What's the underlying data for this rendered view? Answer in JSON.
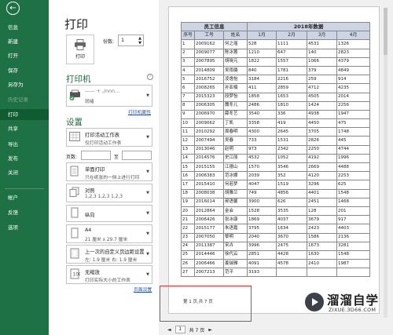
{
  "nav": {
    "back": "←",
    "items": [
      {
        "label": "信息",
        "state": "normal"
      },
      {
        "label": "新建",
        "state": "normal"
      },
      {
        "label": "打开",
        "state": "normal"
      },
      {
        "label": "保存",
        "state": "normal"
      },
      {
        "label": "另存为",
        "state": "normal"
      },
      {
        "label": "历史记录",
        "state": "dim"
      },
      {
        "label": "打印",
        "state": "active"
      },
      {
        "label": "共享",
        "state": "normal"
      },
      {
        "label": "导出",
        "state": "normal"
      },
      {
        "label": "发布",
        "state": "normal"
      },
      {
        "label": "关闭",
        "state": "normal"
      },
      {
        "label": "帐户",
        "state": "normal"
      },
      {
        "label": "反馈",
        "state": "normal"
      },
      {
        "label": "选项",
        "state": "normal"
      }
    ]
  },
  "print": {
    "title": "打印",
    "button_label": "打印",
    "copies_label": "份数:",
    "copies_value": "1"
  },
  "printer": {
    "heading": "打印机",
    "name": "—— + ,/nnn…",
    "status": "就绪",
    "properties_link": "打印机属性"
  },
  "settings": {
    "heading": "设置",
    "scope": {
      "t1": "打印活动工作表",
      "t2": "仅打印活动工作表"
    },
    "pages_label": "页数:",
    "pages_to": "至",
    "sides": {
      "t1": "单面打印",
      "t2": "只在纸张的一侧上进行打印"
    },
    "collate": {
      "t1": "对照",
      "t2": "1,2,3    1,2,3    1,2,3"
    },
    "orientation": {
      "t1": "纵向"
    },
    "paper": {
      "t1": "A4",
      "t2": "21 厘米 x 29.7 厘米"
    },
    "margins": {
      "t1": "上一次的自定义页边距设置",
      "t2": "左: 1.9 厘米    右: 1.9 厘米"
    },
    "scaling": {
      "t1": "无缩放",
      "t2": "打印实际大小的工作表"
    },
    "page_setup_link": "页面设置"
  },
  "preview": {
    "hdr_left": "员工信息",
    "hdr_right": "2018年数据",
    "columns": [
      "序号",
      "工号",
      "姓名",
      "1月",
      "2月",
      "3月",
      "4月"
    ],
    "rows": [
      [
        "1",
        "2009162",
        "何之瑶",
        "528",
        "1111",
        "4531",
        "1326"
      ],
      [
        "2",
        "2009077",
        "陈冰蓉",
        "1210",
        "647",
        "140",
        "2823"
      ],
      [
        "3",
        "2007895",
        "胡晓元",
        "1822",
        "1557",
        "1066",
        "4379"
      ],
      [
        "4",
        "2014809",
        "吴雨璐",
        "840",
        "1781",
        "379",
        "4849"
      ],
      [
        "5",
        "2016752",
        "凌逸怡",
        "3184",
        "2216",
        "259",
        "914"
      ],
      [
        "6",
        "2008265",
        "孙亚楠",
        "411",
        "2859",
        "4712",
        "4235"
      ],
      [
        "7",
        "2015323",
        "段梦怡",
        "1858",
        "1653",
        "4505",
        "2014"
      ],
      [
        "8",
        "2006305",
        "魏冬儿",
        "2486",
        "1810",
        "1424",
        "2256"
      ],
      [
        "9",
        "2006970",
        "薛冬艺",
        "3540",
        "336",
        "4938",
        "1947"
      ],
      [
        "10",
        "2009062",
        "丁凯",
        "3358",
        "419",
        "4450",
        "475"
      ],
      [
        "11",
        "2010292",
        "周春明",
        "4300",
        "2645",
        "3705",
        "1748"
      ],
      [
        "12",
        "2007494",
        "吴春",
        "733",
        "1531",
        "2826",
        "445"
      ],
      [
        "13",
        "2013046",
        "赵明",
        "973",
        "2342",
        "2250",
        "4744"
      ],
      [
        "14",
        "2014576",
        "史江丽",
        "4532",
        "1052",
        "4192",
        "1996"
      ],
      [
        "15",
        "2015155",
        "江德山",
        "1570",
        "3546",
        "2669",
        "4488"
      ],
      [
        "16",
        "2006383",
        "范冰娜",
        "2039",
        "352",
        "4120",
        "2253"
      ],
      [
        "17",
        "2015410",
        "何若梦",
        "4047",
        "1519",
        "3296",
        "625"
      ],
      [
        "18",
        "2008038",
        "胡雅兰",
        "749",
        "4856",
        "4401",
        "1548"
      ],
      [
        "19",
        "2016014",
        "郝语馨",
        "3900",
        "626",
        "2451",
        "1468"
      ],
      [
        "20",
        "2012864",
        "金会",
        "1528",
        "3535",
        "128",
        "201"
      ],
      [
        "21",
        "2006426",
        "张冰康",
        "1869",
        "4037",
        "3679",
        "917"
      ],
      [
        "22",
        "2015177",
        "朱语嘉",
        "3795",
        "1634",
        "2423",
        "4403"
      ],
      [
        "23",
        "2007050",
        "黎明",
        "2040",
        "3670",
        "1586",
        "2136"
      ],
      [
        "24",
        "2011387",
        "宋卉",
        "3996",
        "2475",
        "1673",
        "3281"
      ],
      [
        "25",
        "2014446",
        "徐代云",
        "2851",
        "4428",
        "1630",
        "1548"
      ],
      [
        "26",
        "2006466",
        "姜瑞雅",
        "4091",
        "4578",
        "2410",
        "1987"
      ],
      [
        "27",
        "2007213",
        "范平",
        "3193",
        "",
        "",
        ""
      ]
    ],
    "footer_text": "第 1 页,共 7 页"
  },
  "pager": {
    "prev": "◄",
    "current": "1",
    "total_text": "共 7 页",
    "next": "►"
  },
  "watermark": {
    "text": "溜溜自学",
    "sub": "ZIXUE.3D66.COM"
  }
}
